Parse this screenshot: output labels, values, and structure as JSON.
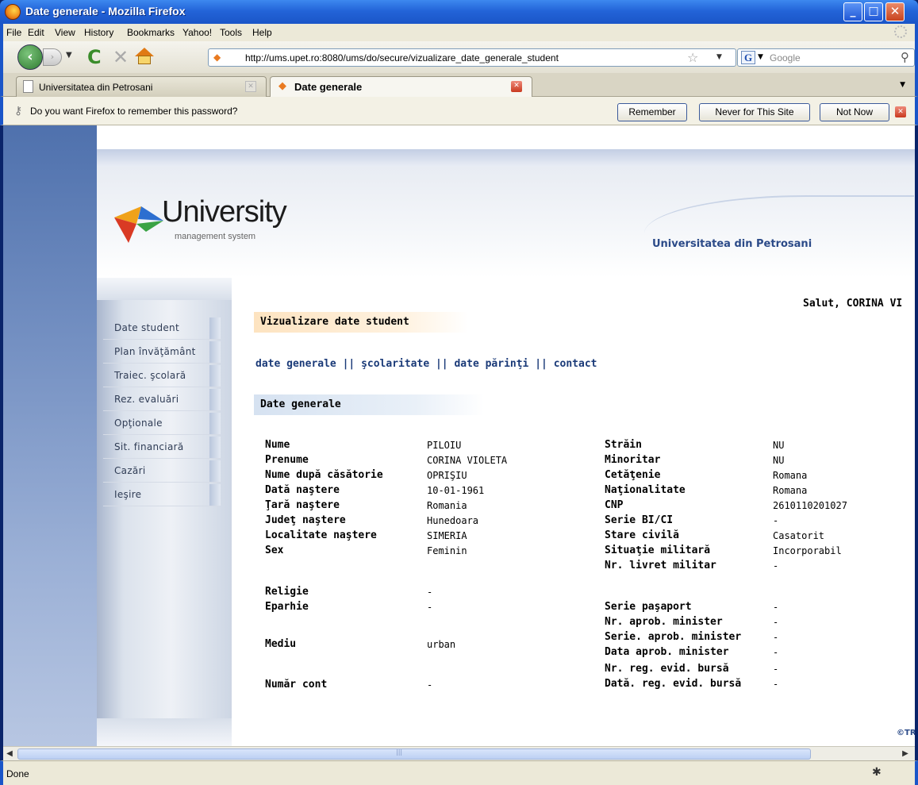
{
  "window": {
    "title": "Date generale - Mozilla Firefox"
  },
  "menu": [
    "File",
    "Edit",
    "View",
    "History",
    "Bookmarks",
    "Yahoo!",
    "Tools",
    "Help"
  ],
  "nav": {
    "url": "http://ums.upet.ro:8080/ums/do/secure/vizualizare_date_generale_student",
    "search_placeholder": "Google"
  },
  "tabs": [
    {
      "label": "Universitatea din Petrosani",
      "active": false
    },
    {
      "label": "Date generale",
      "active": true
    }
  ],
  "notification": {
    "message": "Do you want Firefox to remember this password?",
    "buttons": {
      "remember": "Remember",
      "never": "Never for This Site",
      "not_now": "Not Now"
    }
  },
  "site": {
    "logo_title": "University",
    "logo_subtitle": "management system",
    "university": "Universitatea din Petrosani",
    "greeting": "Salut, CORINA VI",
    "copyright": "©TR"
  },
  "sidebar": [
    "Date student",
    "Plan învăţământ",
    "Traiec. şcolară",
    "Rez. evaluări",
    "Opţionale",
    "Sit. financiară",
    "Cazări",
    "Ieşire"
  ],
  "section_title": "Vizualizare date student",
  "subnav": {
    "links": [
      "date generale",
      "şcolaritate",
      "date părinţi",
      "contact"
    ],
    "separator": "||"
  },
  "subsection_title": "Date generale",
  "left_fields": [
    {
      "label": "Nume",
      "value": "PILOIU"
    },
    {
      "label": "Prenume",
      "value": "CORINA VIOLETA"
    },
    {
      "label": "Nume după căsătorie",
      "value": "OPRIŞIU"
    },
    {
      "label": "Dată naştere",
      "value": "10-01-1961"
    },
    {
      "label": "Ţară naştere",
      "value": "Romania"
    },
    {
      "label": "Judeţ naştere",
      "value": "Hunedoara"
    },
    {
      "label": "Localitate naştere",
      "value": "SIMERIA"
    },
    {
      "label": "Sex",
      "value": "Feminin"
    },
    {
      "label": "Religie",
      "value": "-"
    },
    {
      "label": "Eparhie",
      "value": "-"
    },
    {
      "label": "Mediu",
      "value": "urban"
    },
    {
      "label": "Număr cont",
      "value": "-"
    }
  ],
  "right_fields": [
    {
      "label": "Străin",
      "value": "NU"
    },
    {
      "label": "Minoritar",
      "value": "NU"
    },
    {
      "label": "Cetăţenie",
      "value": "Romana"
    },
    {
      "label": "Naţionalitate",
      "value": "Romana"
    },
    {
      "label": "CNP",
      "value": "2610110201027"
    },
    {
      "label": "Serie BI/CI",
      "value": "-"
    },
    {
      "label": "Stare civilă",
      "value": "Casatorit"
    },
    {
      "label": "Situaţie militară",
      "value": "Incorporabil"
    },
    {
      "label": "Nr. livret militar",
      "value": "-"
    },
    {
      "label": "Serie paşaport",
      "value": "-"
    },
    {
      "label": "Nr. aprob. minister",
      "value": "-"
    },
    {
      "label": "Serie. aprob. minister",
      "value": "-"
    },
    {
      "label": "Data aprob. minister",
      "value": "-"
    },
    {
      "label": "Nr. reg. evid. bursă",
      "value": "-"
    },
    {
      "label": "Dată. reg. evid. bursă",
      "value": "-"
    }
  ],
  "status": {
    "text": "Done"
  }
}
